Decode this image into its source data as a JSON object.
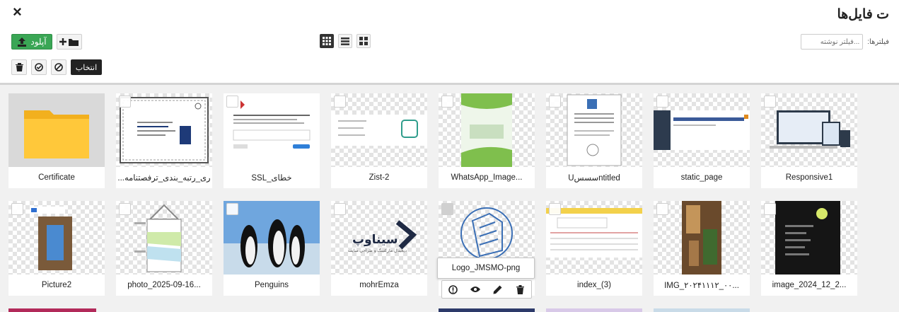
{
  "header": {
    "title": "ت فایل‌ها",
    "close_symbol": "×"
  },
  "toolbar": {
    "upload_label": "آپلود",
    "select_label": "انتخاب",
    "filter_label": "فیلترها:",
    "filter_placeholder": "...فیلتر نوشته",
    "accent_color": "#3aa655"
  },
  "view_modes": [
    {
      "name": "grid-large",
      "active": true
    },
    {
      "name": "list",
      "active": false
    },
    {
      "name": "grid-small",
      "active": false
    }
  ],
  "files": [
    {
      "name": "Certificate",
      "type": "folder"
    },
    {
      "name": "...ری_رتبه_بندی_ترفصتنامه",
      "type": "image"
    },
    {
      "name": "SSL_خطای",
      "type": "image"
    },
    {
      "name": "Zist-2",
      "type": "image"
    },
    {
      "name": "WhatsApp_Image...",
      "type": "image"
    },
    {
      "name": "Uسسسntitled",
      "type": "image"
    },
    {
      "name": "static_page",
      "type": "image"
    },
    {
      "name": "Responsive1",
      "type": "image"
    },
    {
      "name": "Picture2",
      "type": "image"
    },
    {
      "name": "photo_2025-09-16...",
      "type": "image"
    },
    {
      "name": "Penguins",
      "type": "image"
    },
    {
      "name": "mohrEmza",
      "type": "image"
    },
    {
      "name": "Logo_JMSMO-png",
      "type": "image",
      "hovered": true
    },
    {
      "name": "index_(3)",
      "type": "image"
    },
    {
      "name": "IMG_۲۰۲۴۱۱۱۲_۰۰...",
      "type": "image"
    },
    {
      "name": "image_2024_12_2...",
      "type": "image"
    }
  ],
  "logo_text": {
    "brand": "سیناوپ",
    "tagline": "دیجیتال مارکتینگ و طراحی سایت"
  },
  "hover_actions": [
    "info-icon",
    "eye-icon",
    "pencil-icon",
    "trash-icon"
  ]
}
